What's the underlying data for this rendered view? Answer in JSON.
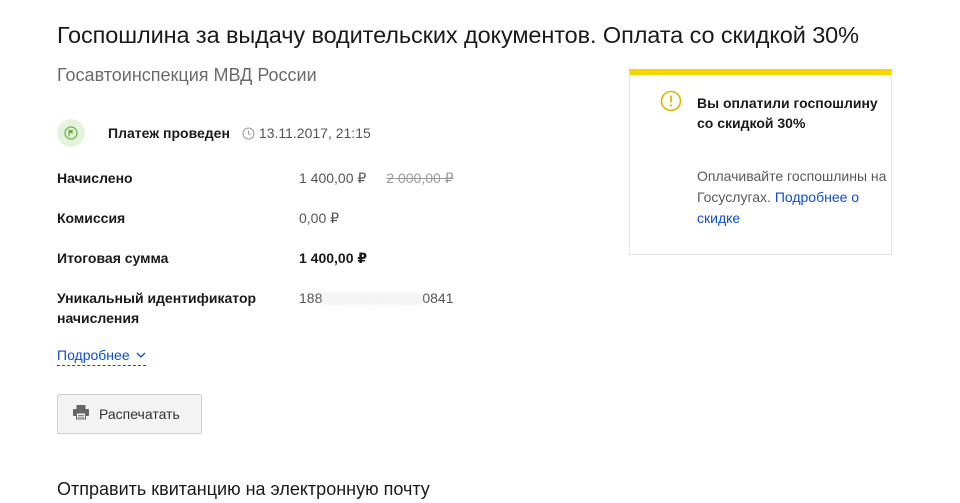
{
  "page": {
    "title": "Госпошлина за выдачу водительских документов. Оплата со скидкой 30%",
    "organization": "Госавтоинспекция МВД России"
  },
  "status": {
    "text": "Платеж проведен",
    "datetime": "13.11.2017, 21:15",
    "icon": "flag-icon",
    "color": "#6ab04c"
  },
  "details": {
    "rows": [
      {
        "label": "Начислено",
        "value": "1 400,00 ₽",
        "old_value": "2 000,00 ₽"
      },
      {
        "label": "Комиссия",
        "value": "0,00 ₽"
      },
      {
        "label": "Итоговая сумма",
        "value": "1 400,00 ₽"
      },
      {
        "label": "Уникальный идентификатор начисления",
        "value_start": "188",
        "value_end": "0841"
      }
    ],
    "more_link": "Подробнее"
  },
  "actions": {
    "print_label": "Распечатать"
  },
  "email": {
    "heading": "Отправить квитанцию на электронную почту"
  },
  "notice": {
    "title": "Вы оплатили госпошлину со скидкой 30%",
    "text": "Оплачивайте госпошлины на Госуслугах.",
    "link": "Подробнее о скидке",
    "accent_color": "#f5d400"
  },
  "colors": {
    "link": "#0d4cd3",
    "warning": "#f5d400"
  }
}
